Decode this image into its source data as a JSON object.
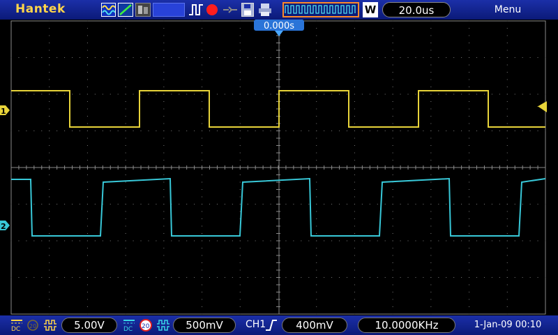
{
  "brand": "Hantek",
  "top_bar": {
    "timebase": "20.0us",
    "trigger_mode_badge": "W",
    "menu_label": "Menu",
    "icons": [
      "waveform-mode-icon",
      "slope-icon",
      "display-mode-icon",
      "run-stop-icon",
      "record-icon",
      "ref-icon",
      "save-icon",
      "print-icon"
    ]
  },
  "trigger_position_label": "0.000s",
  "channels": {
    "ch1": {
      "marker": "1",
      "color": "#e8d43a",
      "coupling": "DC",
      "volts_per_div": "5.00V"
    },
    "ch2": {
      "marker": "2",
      "color": "#38c8d8",
      "coupling": "DC",
      "bandwidth_limit": "20",
      "volts_per_div": "500mV"
    }
  },
  "trigger": {
    "source": "CH1",
    "level": "400mV"
  },
  "frequency": "10.0000KHz",
  "datetime": "1-Jan-09 00:10",
  "colors": {
    "bar": "#0b1a78",
    "grid": "#8a8a8a",
    "preview_border": "#ff8a2a",
    "record": "#ff1e1e"
  }
}
